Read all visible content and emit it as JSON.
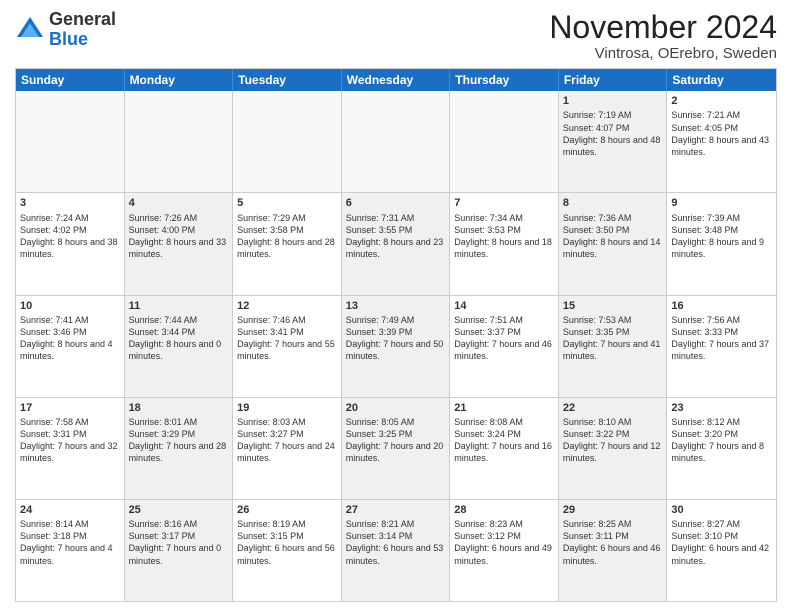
{
  "header": {
    "logo_line1": "General",
    "logo_line2": "Blue",
    "title": "November 2024",
    "subtitle": "Vintrosa, OErebro, Sweden"
  },
  "weekdays": [
    "Sunday",
    "Monday",
    "Tuesday",
    "Wednesday",
    "Thursday",
    "Friday",
    "Saturday"
  ],
  "rows": [
    [
      {
        "day": "",
        "info": "",
        "empty": true
      },
      {
        "day": "",
        "info": "",
        "empty": true
      },
      {
        "day": "",
        "info": "",
        "empty": true
      },
      {
        "day": "",
        "info": "",
        "empty": true
      },
      {
        "day": "",
        "info": "",
        "empty": true
      },
      {
        "day": "1",
        "info": "Sunrise: 7:19 AM\nSunset: 4:07 PM\nDaylight: 8 hours and 48 minutes.",
        "shaded": true
      },
      {
        "day": "2",
        "info": "Sunrise: 7:21 AM\nSunset: 4:05 PM\nDaylight: 8 hours and 43 minutes.",
        "shaded": false
      }
    ],
    [
      {
        "day": "3",
        "info": "Sunrise: 7:24 AM\nSunset: 4:02 PM\nDaylight: 8 hours and 38 minutes.",
        "shaded": false
      },
      {
        "day": "4",
        "info": "Sunrise: 7:26 AM\nSunset: 4:00 PM\nDaylight: 8 hours and 33 minutes.",
        "shaded": true
      },
      {
        "day": "5",
        "info": "Sunrise: 7:29 AM\nSunset: 3:58 PM\nDaylight: 8 hours and 28 minutes.",
        "shaded": false
      },
      {
        "day": "6",
        "info": "Sunrise: 7:31 AM\nSunset: 3:55 PM\nDaylight: 8 hours and 23 minutes.",
        "shaded": true
      },
      {
        "day": "7",
        "info": "Sunrise: 7:34 AM\nSunset: 3:53 PM\nDaylight: 8 hours and 18 minutes.",
        "shaded": false
      },
      {
        "day": "8",
        "info": "Sunrise: 7:36 AM\nSunset: 3:50 PM\nDaylight: 8 hours and 14 minutes.",
        "shaded": true
      },
      {
        "day": "9",
        "info": "Sunrise: 7:39 AM\nSunset: 3:48 PM\nDaylight: 8 hours and 9 minutes.",
        "shaded": false
      }
    ],
    [
      {
        "day": "10",
        "info": "Sunrise: 7:41 AM\nSunset: 3:46 PM\nDaylight: 8 hours and 4 minutes.",
        "shaded": false
      },
      {
        "day": "11",
        "info": "Sunrise: 7:44 AM\nSunset: 3:44 PM\nDaylight: 8 hours and 0 minutes.",
        "shaded": true
      },
      {
        "day": "12",
        "info": "Sunrise: 7:46 AM\nSunset: 3:41 PM\nDaylight: 7 hours and 55 minutes.",
        "shaded": false
      },
      {
        "day": "13",
        "info": "Sunrise: 7:49 AM\nSunset: 3:39 PM\nDaylight: 7 hours and 50 minutes.",
        "shaded": true
      },
      {
        "day": "14",
        "info": "Sunrise: 7:51 AM\nSunset: 3:37 PM\nDaylight: 7 hours and 46 minutes.",
        "shaded": false
      },
      {
        "day": "15",
        "info": "Sunrise: 7:53 AM\nSunset: 3:35 PM\nDaylight: 7 hours and 41 minutes.",
        "shaded": true
      },
      {
        "day": "16",
        "info": "Sunrise: 7:56 AM\nSunset: 3:33 PM\nDaylight: 7 hours and 37 minutes.",
        "shaded": false
      }
    ],
    [
      {
        "day": "17",
        "info": "Sunrise: 7:58 AM\nSunset: 3:31 PM\nDaylight: 7 hours and 32 minutes.",
        "shaded": false
      },
      {
        "day": "18",
        "info": "Sunrise: 8:01 AM\nSunset: 3:29 PM\nDaylight: 7 hours and 28 minutes.",
        "shaded": true
      },
      {
        "day": "19",
        "info": "Sunrise: 8:03 AM\nSunset: 3:27 PM\nDaylight: 7 hours and 24 minutes.",
        "shaded": false
      },
      {
        "day": "20",
        "info": "Sunrise: 8:05 AM\nSunset: 3:25 PM\nDaylight: 7 hours and 20 minutes.",
        "shaded": true
      },
      {
        "day": "21",
        "info": "Sunrise: 8:08 AM\nSunset: 3:24 PM\nDaylight: 7 hours and 16 minutes.",
        "shaded": false
      },
      {
        "day": "22",
        "info": "Sunrise: 8:10 AM\nSunset: 3:22 PM\nDaylight: 7 hours and 12 minutes.",
        "shaded": true
      },
      {
        "day": "23",
        "info": "Sunrise: 8:12 AM\nSunset: 3:20 PM\nDaylight: 7 hours and 8 minutes.",
        "shaded": false
      }
    ],
    [
      {
        "day": "24",
        "info": "Sunrise: 8:14 AM\nSunset: 3:18 PM\nDaylight: 7 hours and 4 minutes.",
        "shaded": false
      },
      {
        "day": "25",
        "info": "Sunrise: 8:16 AM\nSunset: 3:17 PM\nDaylight: 7 hours and 0 minutes.",
        "shaded": true
      },
      {
        "day": "26",
        "info": "Sunrise: 8:19 AM\nSunset: 3:15 PM\nDaylight: 6 hours and 56 minutes.",
        "shaded": false
      },
      {
        "day": "27",
        "info": "Sunrise: 8:21 AM\nSunset: 3:14 PM\nDaylight: 6 hours and 53 minutes.",
        "shaded": true
      },
      {
        "day": "28",
        "info": "Sunrise: 8:23 AM\nSunset: 3:12 PM\nDaylight: 6 hours and 49 minutes.",
        "shaded": false
      },
      {
        "day": "29",
        "info": "Sunrise: 8:25 AM\nSunset: 3:11 PM\nDaylight: 6 hours and 46 minutes.",
        "shaded": true
      },
      {
        "day": "30",
        "info": "Sunrise: 8:27 AM\nSunset: 3:10 PM\nDaylight: 6 hours and 42 minutes.",
        "shaded": false
      }
    ]
  ]
}
